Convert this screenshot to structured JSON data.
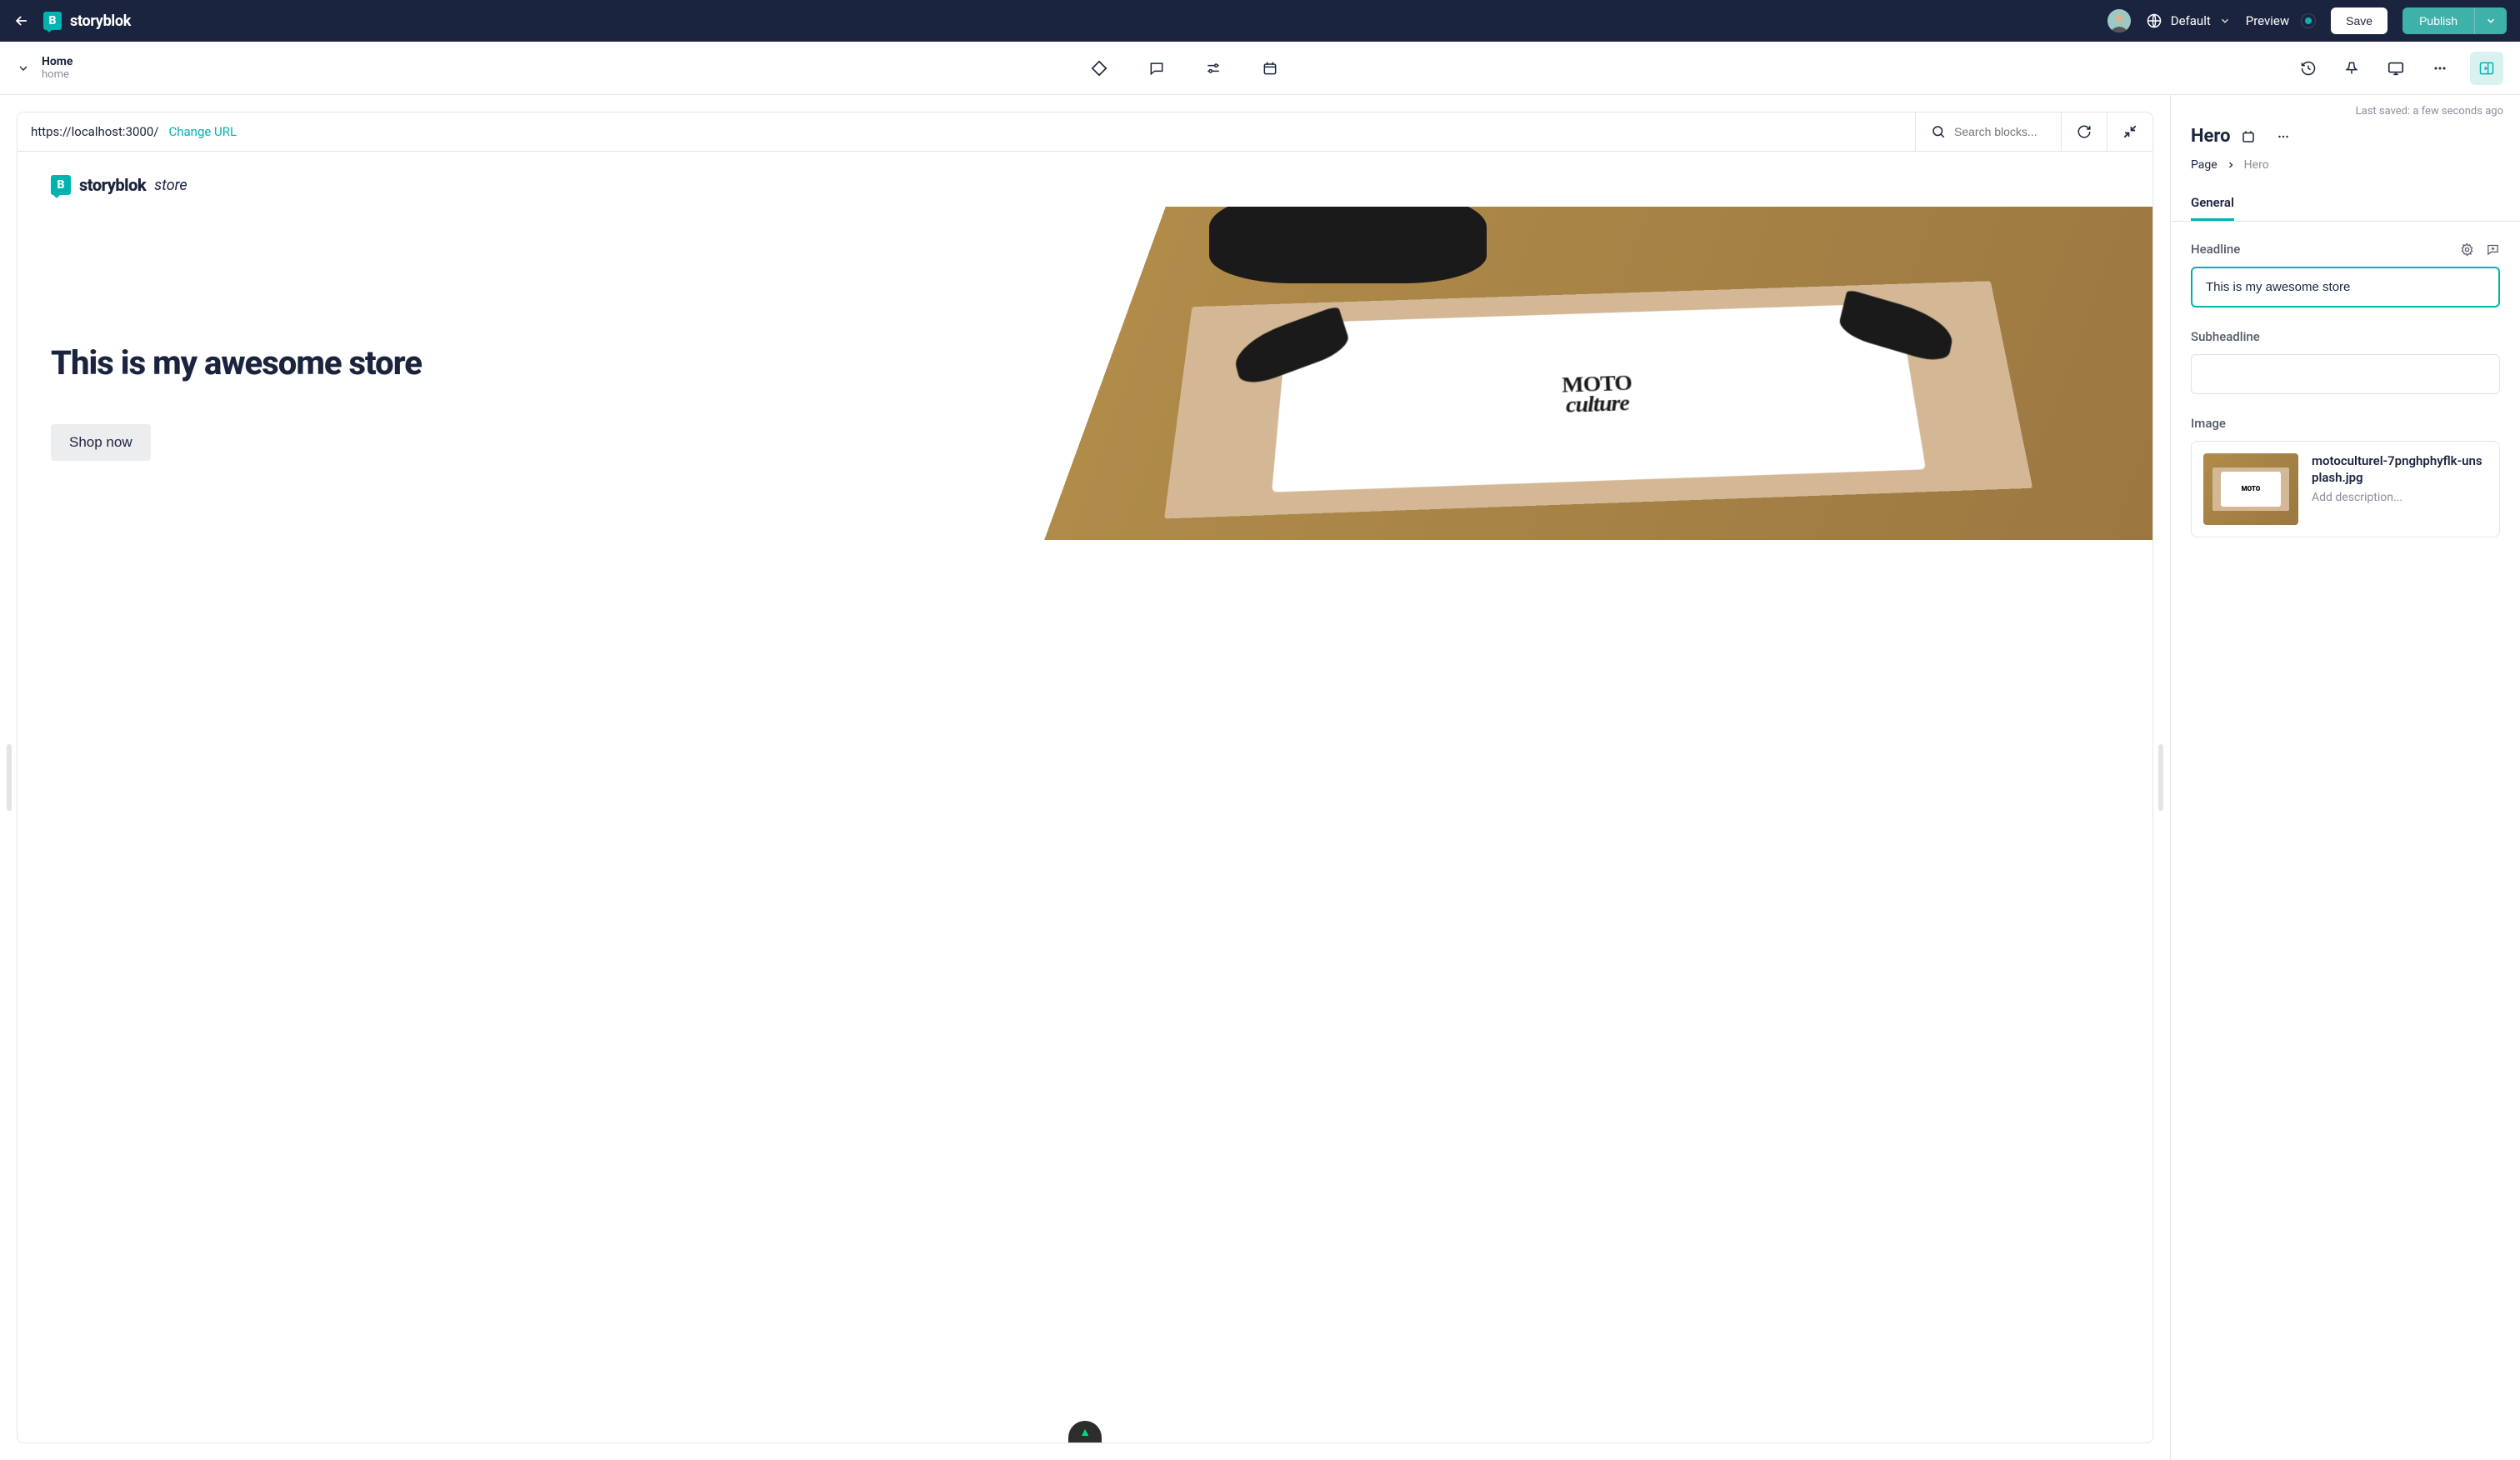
{
  "brand": {
    "name": "storyblok"
  },
  "topbar": {
    "language": "Default",
    "preview": "Preview",
    "save": "Save",
    "publish": "Publish"
  },
  "page": {
    "title": "Home",
    "slug": "home"
  },
  "urlbar": {
    "url": "https://localhost:3000/",
    "change_url": "Change URL",
    "search_placeholder": "Search blocks..."
  },
  "site": {
    "brand_main": "storyblok",
    "brand_sub": "store",
    "hero_headline": "This is my awesome store",
    "shop_button": "Shop now",
    "tshirt_text_top": "MOTO",
    "tshirt_text_bottom": "culture"
  },
  "nuxt_symbol": "▲",
  "panel": {
    "last_saved": "Last saved: a few seconds ago",
    "block_title": "Hero",
    "breadcrumb": {
      "root": "Page",
      "current": "Hero"
    },
    "tab": "General",
    "fields": {
      "headline": {
        "label": "Headline",
        "value": "This is my awesome store"
      },
      "subheadline": {
        "label": "Subheadline",
        "value": ""
      },
      "image": {
        "label": "Image",
        "filename": "motoculturel-7pnghphyflk-unsplash.jpg",
        "description_placeholder": "Add description..."
      }
    }
  }
}
